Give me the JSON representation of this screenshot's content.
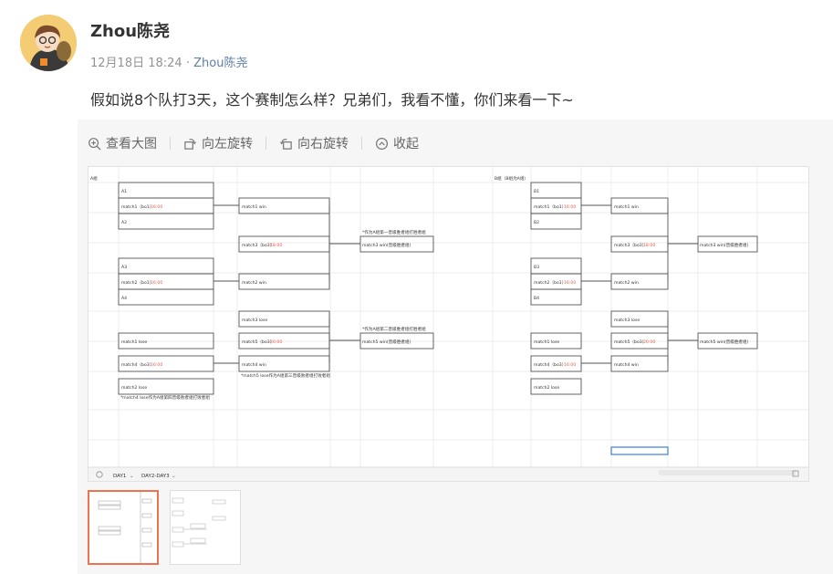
{
  "post": {
    "username": "Zhou陈尧",
    "date": "12月18日 18:24",
    "separator": "·",
    "source": "Zhou陈尧",
    "text": "假如说8个队打3天，这个赛制怎么样？兄弟们，我看不懂，你们来看一下~"
  },
  "toolbar": {
    "view_large": "查看大图",
    "rotate_left": "向左旋转",
    "rotate_right": "向右旋转",
    "collapse": "收起"
  },
  "sheet": {
    "groupA_label": "A组",
    "groupB_label": "B组（B组为A组）",
    "teams": {
      "A1": "A1",
      "A2": "A2",
      "A3": "A3",
      "A4": "A4",
      "B1": "B1",
      "B2": "B2",
      "B3": "B3",
      "B4": "B4"
    },
    "match1": "match1（bo1）",
    "match2": "match2（bo1）",
    "match3": "match3（bo3）",
    "match4": "match4（bo3）",
    "match5": "match5（bo3）",
    "match1_win": "match1 win",
    "match2_win": "match2 win",
    "match1_lose": "match1 lose",
    "match2_lose": "match2 lose",
    "match3_lose": "match3 lose",
    "match4_win": "match4 win",
    "match3_win_adv": "match3 win(晋级胜者组)",
    "match5_win_adv": "match5 win(晋级胜者组)",
    "time_1600": "16:00",
    "time_1800": "18:00",
    "time_2000": "20:00",
    "note_winner": "*作为A组第一晋级胜者组打胜者组",
    "note_second": "*作为A组第二晋级胜者组打胜者组",
    "note_match5_lose": "*match5 lose作为A组第三晋级败者组打败者组",
    "note_match4_lose": "*match4 lose作为A组第四晋级败者组打败者组"
  },
  "tabs": {
    "day1": "DAY1",
    "day2": "DAY2-DAY3",
    "chevron": "⌄"
  },
  "colors": {
    "time_red": "#e8584a",
    "active_border": "#eb7350",
    "link_blue": "#5d7fa8"
  }
}
